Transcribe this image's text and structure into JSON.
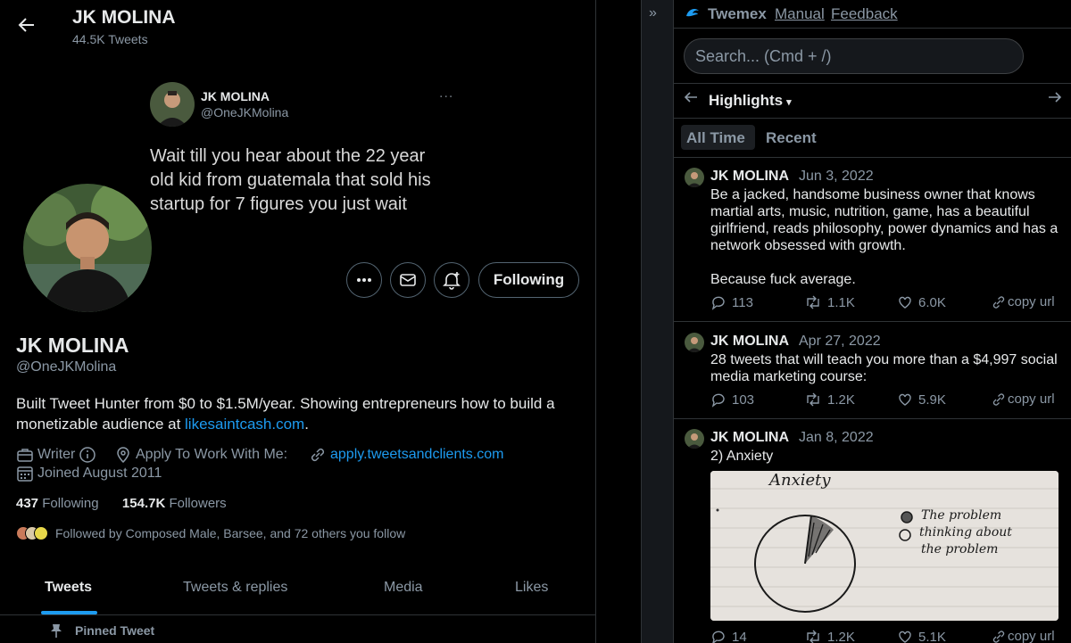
{
  "header": {
    "name": "JK MOLINA",
    "tweet_count": "44.5K Tweets"
  },
  "banner": {
    "name": "JK MOLINA",
    "handle": "@OneJKMolina",
    "more": "...",
    "text": "Wait till you hear about the 22 year old kid from guatemala that sold his startup for 7 figures you just wait"
  },
  "profile": {
    "name": "JK MOLINA",
    "handle": "@OneJKMolina",
    "bio_text": "Built Tweet Hunter from $0 to $1.5M/year. Showing entrepreneurs how to build a monetizable audience at ",
    "bio_link": "likesaintcash.com",
    "bio_end": ".",
    "job": "Writer",
    "location": "Apply To Work With Me:",
    "website": "apply.tweetsandclients.com",
    "joined": "Joined August 2011",
    "following_count": "437",
    "following_label": "Following",
    "followers_count": "154.7K",
    "followers_label": "Followers",
    "followed_by": "Followed by Composed Male, Barsee, and 72 others you follow",
    "follow_button": "Following"
  },
  "tabs": [
    "Tweets",
    "Tweets & replies",
    "Media",
    "Likes"
  ],
  "pinned_label": "Pinned Tweet",
  "twemex": {
    "collapse": "»",
    "title": "Twemex",
    "manual": "Manual",
    "feedback": "Feedback",
    "search_placeholder": "Search... (Cmd + /)",
    "section": "Highlights",
    "section_caret": "▾",
    "segments": [
      "All Time",
      "Recent"
    ],
    "tweets": [
      {
        "name": "JK MOLINA",
        "date": "Jun 3, 2022",
        "text": "Be a jacked, handsome business owner that knows martial arts, music, nutrition, game, has a beautiful girlfriend, reads philosophy, power dynamics and has a network obsessed with growth.\n\nBecause fuck average.",
        "replies": "113",
        "retweets": "1.1K",
        "likes": "6.0K",
        "copy": "copy url"
      },
      {
        "name": "JK MOLINA",
        "date": "Apr 27, 2022",
        "text": "28 tweets that will teach you more than a $4,997 social media marketing course:",
        "replies": "103",
        "retweets": "1.2K",
        "likes": "5.9K",
        "copy": "copy url"
      },
      {
        "name": "JK MOLINA",
        "date": "Jan 8, 2022",
        "text": "2) Anxiety",
        "replies": "14",
        "retweets": "1.2K",
        "likes": "5.1K",
        "copy": "copy url",
        "image": {
          "title": "Anxiety",
          "legend": [
            "The problem",
            "thinking about",
            "the problem"
          ]
        }
      }
    ]
  },
  "colors": {
    "accent": "#1d9bf0",
    "bg": "#000000",
    "muted": "#8b98a5",
    "border": "#2f3336"
  }
}
